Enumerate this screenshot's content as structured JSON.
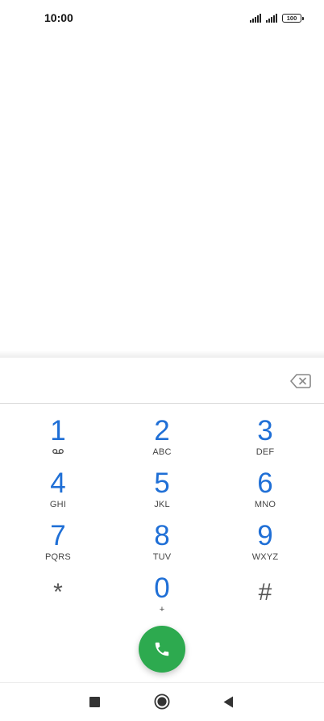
{
  "status_bar": {
    "time": "10:00",
    "battery": "100"
  },
  "dialer": {
    "number_value": "",
    "keys": [
      {
        "digit": "1",
        "letters": "",
        "icon": "voicemail-icon"
      },
      {
        "digit": "2",
        "letters": "ABC"
      },
      {
        "digit": "3",
        "letters": "DEF"
      },
      {
        "digit": "4",
        "letters": "GHI"
      },
      {
        "digit": "5",
        "letters": "JKL"
      },
      {
        "digit": "6",
        "letters": "MNO"
      },
      {
        "digit": "7",
        "letters": "PQRS"
      },
      {
        "digit": "8",
        "letters": "TUV"
      },
      {
        "digit": "9",
        "letters": "WXYZ"
      },
      {
        "digit": "*",
        "letters": ""
      },
      {
        "digit": "0",
        "letters": "+"
      },
      {
        "digit": "#",
        "letters": ""
      }
    ]
  },
  "icons": {
    "backspace": "backspace-icon",
    "call": "phone-icon",
    "nav_recents": "square-icon",
    "nav_home": "circle-icon",
    "nav_back": "triangle-back-icon"
  },
  "colors": {
    "digit": "#1f6fd6",
    "call_button": "#2daa4f"
  }
}
